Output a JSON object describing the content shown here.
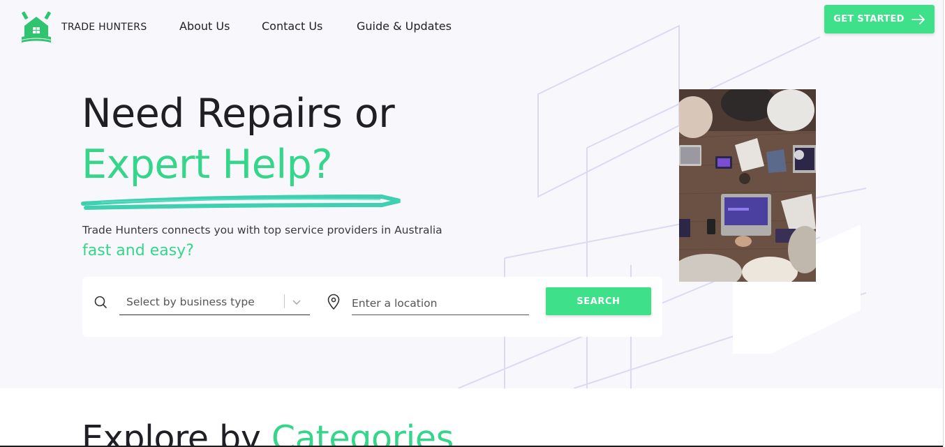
{
  "header": {
    "brand": "TRADE HUNTERS",
    "logo_icon": "house-tools-book-logo",
    "nav": [
      {
        "label": "About Us"
      },
      {
        "label": "Contact Us"
      },
      {
        "label": "Guide & Updates"
      }
    ],
    "cta_label": "GET STARTED",
    "cta_icon": "arrow-right-icon"
  },
  "hero": {
    "title_line1": "Need Repairs or",
    "title_line2": "Expert Help?",
    "subtitle": "Trade Hunters connects you with top service providers in Australia",
    "subtitle_highlight": "fast and easy?",
    "search": {
      "business_type_placeholder": "Select by business type",
      "location_placeholder": "Enter a location",
      "button_label": "SEARCH"
    },
    "image_icon": "team-meeting-photo"
  },
  "categories": {
    "title_prefix": "Explore by",
    "title_highlight": "Categories"
  },
  "colors": {
    "accent_green": "#3ee08a",
    "headline_green": "#35d68a",
    "hero_background": "#f8f7fc",
    "decor_lines": "#dcd9f3",
    "text_dark": "#1f1f25"
  }
}
